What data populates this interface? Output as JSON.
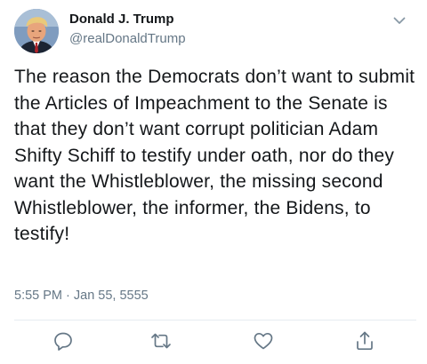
{
  "user": {
    "display_name": "Donald J. Trump",
    "handle": "@realDonaldTrump",
    "avatar_icon": "profile-photo-avatar"
  },
  "menu": {
    "icon": "chevron-down-icon"
  },
  "tweet": {
    "text": "The reason the Democrats don’t want to submit the Articles of Impeachment to the Senate is that they don’t want corrupt politician Adam Shifty Schiff to testify under oath, nor do they want the Whistleblower, the missing second Whistleblower, the informer, the Bidens, to testify!",
    "timestamp": "5:55 PM · Jan 55, 5555"
  },
  "actions": [
    {
      "name": "reply",
      "icon": "reply-icon"
    },
    {
      "name": "retweet",
      "icon": "retweet-icon"
    },
    {
      "name": "like",
      "icon": "heart-icon"
    },
    {
      "name": "share",
      "icon": "share-icon"
    }
  ],
  "colors": {
    "text_primary": "#14171a",
    "text_secondary": "#657786",
    "divider": "#e6ecf0"
  }
}
